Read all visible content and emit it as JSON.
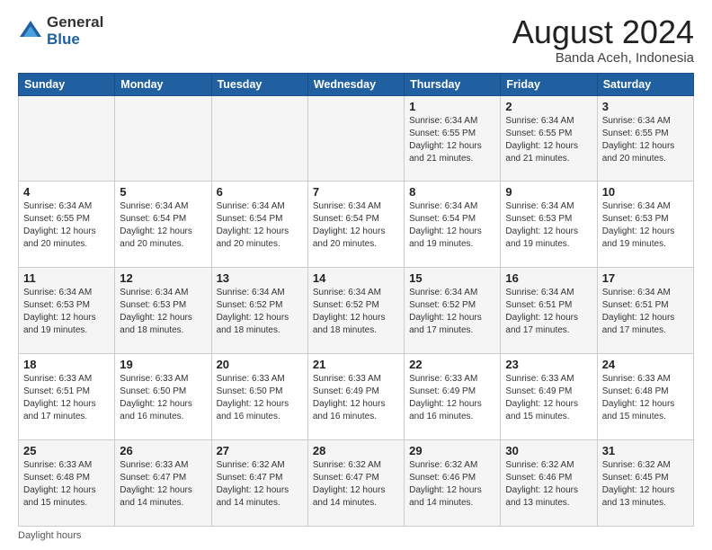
{
  "logo": {
    "general": "General",
    "blue": "Blue"
  },
  "title": {
    "month_year": "August 2024",
    "location": "Banda Aceh, Indonesia"
  },
  "header_days": [
    "Sunday",
    "Monday",
    "Tuesday",
    "Wednesday",
    "Thursday",
    "Friday",
    "Saturday"
  ],
  "weeks": [
    [
      {
        "day": "",
        "info": ""
      },
      {
        "day": "",
        "info": ""
      },
      {
        "day": "",
        "info": ""
      },
      {
        "day": "",
        "info": ""
      },
      {
        "day": "1",
        "info": "Sunrise: 6:34 AM\nSunset: 6:55 PM\nDaylight: 12 hours\nand 21 minutes."
      },
      {
        "day": "2",
        "info": "Sunrise: 6:34 AM\nSunset: 6:55 PM\nDaylight: 12 hours\nand 21 minutes."
      },
      {
        "day": "3",
        "info": "Sunrise: 6:34 AM\nSunset: 6:55 PM\nDaylight: 12 hours\nand 20 minutes."
      }
    ],
    [
      {
        "day": "4",
        "info": "Sunrise: 6:34 AM\nSunset: 6:55 PM\nDaylight: 12 hours\nand 20 minutes."
      },
      {
        "day": "5",
        "info": "Sunrise: 6:34 AM\nSunset: 6:54 PM\nDaylight: 12 hours\nand 20 minutes."
      },
      {
        "day": "6",
        "info": "Sunrise: 6:34 AM\nSunset: 6:54 PM\nDaylight: 12 hours\nand 20 minutes."
      },
      {
        "day": "7",
        "info": "Sunrise: 6:34 AM\nSunset: 6:54 PM\nDaylight: 12 hours\nand 20 minutes."
      },
      {
        "day": "8",
        "info": "Sunrise: 6:34 AM\nSunset: 6:54 PM\nDaylight: 12 hours\nand 19 minutes."
      },
      {
        "day": "9",
        "info": "Sunrise: 6:34 AM\nSunset: 6:53 PM\nDaylight: 12 hours\nand 19 minutes."
      },
      {
        "day": "10",
        "info": "Sunrise: 6:34 AM\nSunset: 6:53 PM\nDaylight: 12 hours\nand 19 minutes."
      }
    ],
    [
      {
        "day": "11",
        "info": "Sunrise: 6:34 AM\nSunset: 6:53 PM\nDaylight: 12 hours\nand 19 minutes."
      },
      {
        "day": "12",
        "info": "Sunrise: 6:34 AM\nSunset: 6:53 PM\nDaylight: 12 hours\nand 18 minutes."
      },
      {
        "day": "13",
        "info": "Sunrise: 6:34 AM\nSunset: 6:52 PM\nDaylight: 12 hours\nand 18 minutes."
      },
      {
        "day": "14",
        "info": "Sunrise: 6:34 AM\nSunset: 6:52 PM\nDaylight: 12 hours\nand 18 minutes."
      },
      {
        "day": "15",
        "info": "Sunrise: 6:34 AM\nSunset: 6:52 PM\nDaylight: 12 hours\nand 17 minutes."
      },
      {
        "day": "16",
        "info": "Sunrise: 6:34 AM\nSunset: 6:51 PM\nDaylight: 12 hours\nand 17 minutes."
      },
      {
        "day": "17",
        "info": "Sunrise: 6:34 AM\nSunset: 6:51 PM\nDaylight: 12 hours\nand 17 minutes."
      }
    ],
    [
      {
        "day": "18",
        "info": "Sunrise: 6:33 AM\nSunset: 6:51 PM\nDaylight: 12 hours\nand 17 minutes."
      },
      {
        "day": "19",
        "info": "Sunrise: 6:33 AM\nSunset: 6:50 PM\nDaylight: 12 hours\nand 16 minutes."
      },
      {
        "day": "20",
        "info": "Sunrise: 6:33 AM\nSunset: 6:50 PM\nDaylight: 12 hours\nand 16 minutes."
      },
      {
        "day": "21",
        "info": "Sunrise: 6:33 AM\nSunset: 6:49 PM\nDaylight: 12 hours\nand 16 minutes."
      },
      {
        "day": "22",
        "info": "Sunrise: 6:33 AM\nSunset: 6:49 PM\nDaylight: 12 hours\nand 16 minutes."
      },
      {
        "day": "23",
        "info": "Sunrise: 6:33 AM\nSunset: 6:49 PM\nDaylight: 12 hours\nand 15 minutes."
      },
      {
        "day": "24",
        "info": "Sunrise: 6:33 AM\nSunset: 6:48 PM\nDaylight: 12 hours\nand 15 minutes."
      }
    ],
    [
      {
        "day": "25",
        "info": "Sunrise: 6:33 AM\nSunset: 6:48 PM\nDaylight: 12 hours\nand 15 minutes."
      },
      {
        "day": "26",
        "info": "Sunrise: 6:33 AM\nSunset: 6:47 PM\nDaylight: 12 hours\nand 14 minutes."
      },
      {
        "day": "27",
        "info": "Sunrise: 6:32 AM\nSunset: 6:47 PM\nDaylight: 12 hours\nand 14 minutes."
      },
      {
        "day": "28",
        "info": "Sunrise: 6:32 AM\nSunset: 6:47 PM\nDaylight: 12 hours\nand 14 minutes."
      },
      {
        "day": "29",
        "info": "Sunrise: 6:32 AM\nSunset: 6:46 PM\nDaylight: 12 hours\nand 14 minutes."
      },
      {
        "day": "30",
        "info": "Sunrise: 6:32 AM\nSunset: 6:46 PM\nDaylight: 12 hours\nand 13 minutes."
      },
      {
        "day": "31",
        "info": "Sunrise: 6:32 AM\nSunset: 6:45 PM\nDaylight: 12 hours\nand 13 minutes."
      }
    ]
  ],
  "footer": {
    "note": "Daylight hours"
  },
  "colors": {
    "header_bg": "#2060a0",
    "accent": "#2060a0"
  }
}
